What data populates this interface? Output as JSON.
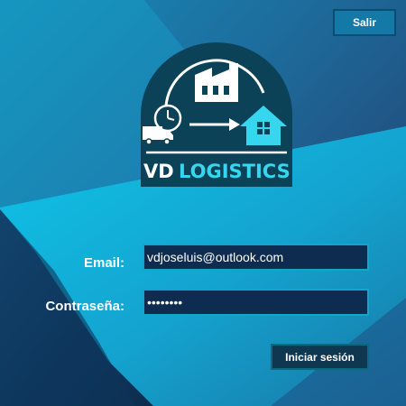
{
  "header": {
    "exit_label": "Salir"
  },
  "logo": {
    "brand_prefix": "VD",
    "brand_name": "LOGISTICS"
  },
  "form": {
    "email_label": "Email:",
    "email_value": "vdjoseluis@outlook.com",
    "password_label": "Contraseña:",
    "password_value": "12345678",
    "login_label": "Iniciar sesión"
  },
  "colors": {
    "logo_bg": "#0b4257",
    "accent": "#37d6ef",
    "field_bg": "#0d2c50",
    "button_bg": "#0f3850"
  },
  "icons": [
    "factory-icon",
    "clock-icon",
    "truck-icon",
    "arrow-right-icon",
    "house-icon"
  ]
}
